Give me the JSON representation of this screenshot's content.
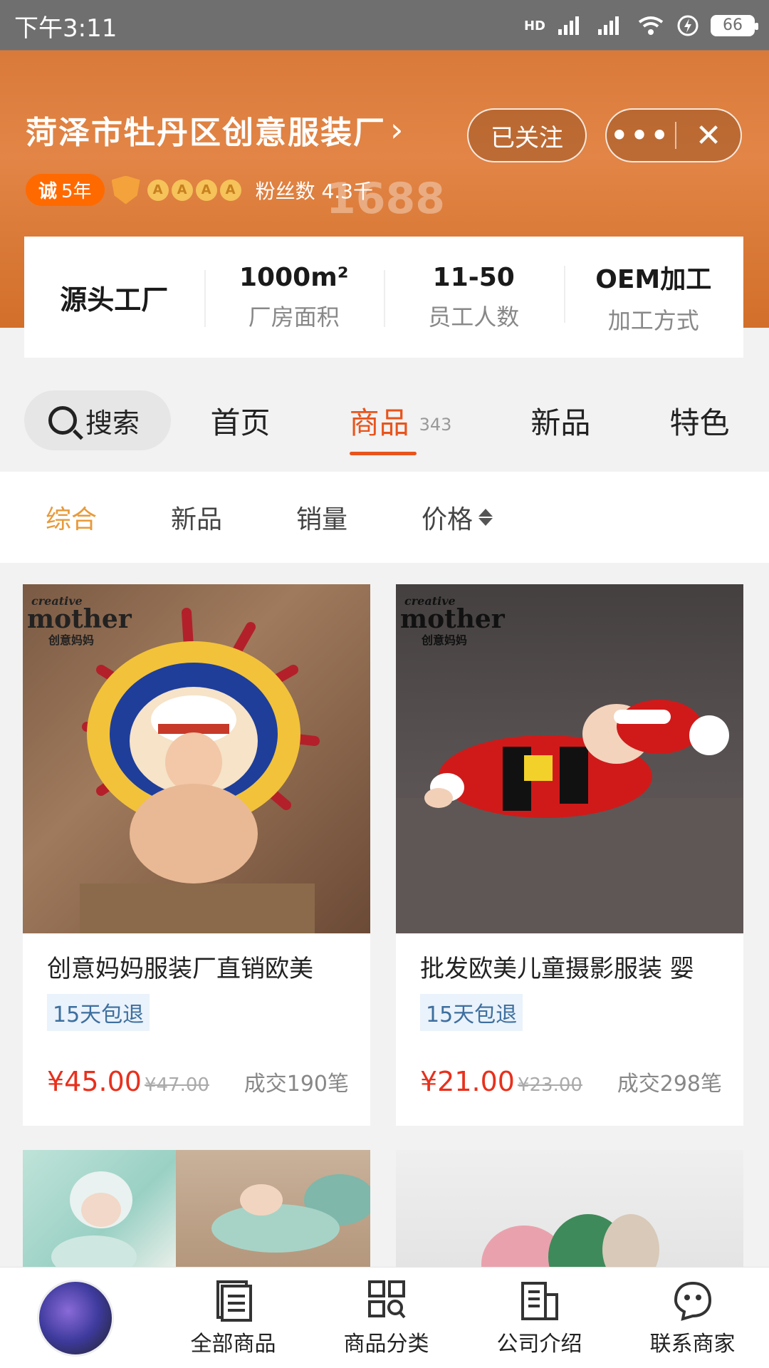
{
  "status_bar": {
    "time": "下午3:11",
    "battery": "66",
    "network": "HD"
  },
  "shop": {
    "name": "菏泽市牡丹区创意服装厂",
    "follow_label": "已关注",
    "cheng_badge": "诚",
    "cheng_years": "5年",
    "crowns": [
      "A",
      "A",
      "A",
      "A"
    ],
    "fans_label": "粉丝数 4.3千",
    "watermark": "1688"
  },
  "factory": {
    "main_label": "源头工厂",
    "stats": [
      {
        "value": "1000m²",
        "label": "厂房面积"
      },
      {
        "value": "11-50",
        "label": "员工人数"
      },
      {
        "value": "OEM加工",
        "label": "加工方式"
      }
    ]
  },
  "nav": {
    "search_label": "搜索",
    "tabs": [
      {
        "label": "首页"
      },
      {
        "label": "商品",
        "count": "343",
        "active": true
      },
      {
        "label": "新品"
      },
      {
        "label": "特色"
      }
    ]
  },
  "sort": {
    "items": [
      "综合",
      "新品",
      "销量",
      "价格"
    ],
    "active": "综合"
  },
  "products": [
    {
      "title": "创意妈妈服装厂直销欧美",
      "tag": "15天包退",
      "price": "¥45.00",
      "orig_price": "¥47.00",
      "sold": "成交190笔",
      "logo_small": "creative",
      "logo_big": "mother",
      "logo_cn": "创意妈妈"
    },
    {
      "title": "批发欧美儿童摄影服装 婴",
      "tag": "15天包退",
      "price": "¥21.00",
      "orig_price": "¥23.00",
      "sold": "成交298笔",
      "logo_small": "creative",
      "logo_big": "mother",
      "logo_cn": "创意妈妈"
    }
  ],
  "bottom_tabs": [
    {
      "label": "全部商品",
      "icon": "document-list-icon"
    },
    {
      "label": "商品分类",
      "icon": "category-grid-icon"
    },
    {
      "label": "公司介绍",
      "icon": "building-icon"
    },
    {
      "label": "联系商家",
      "icon": "chat-face-icon"
    }
  ],
  "colors": {
    "accent": "#e8541c",
    "price": "#e8301c",
    "header": "#e28546"
  }
}
